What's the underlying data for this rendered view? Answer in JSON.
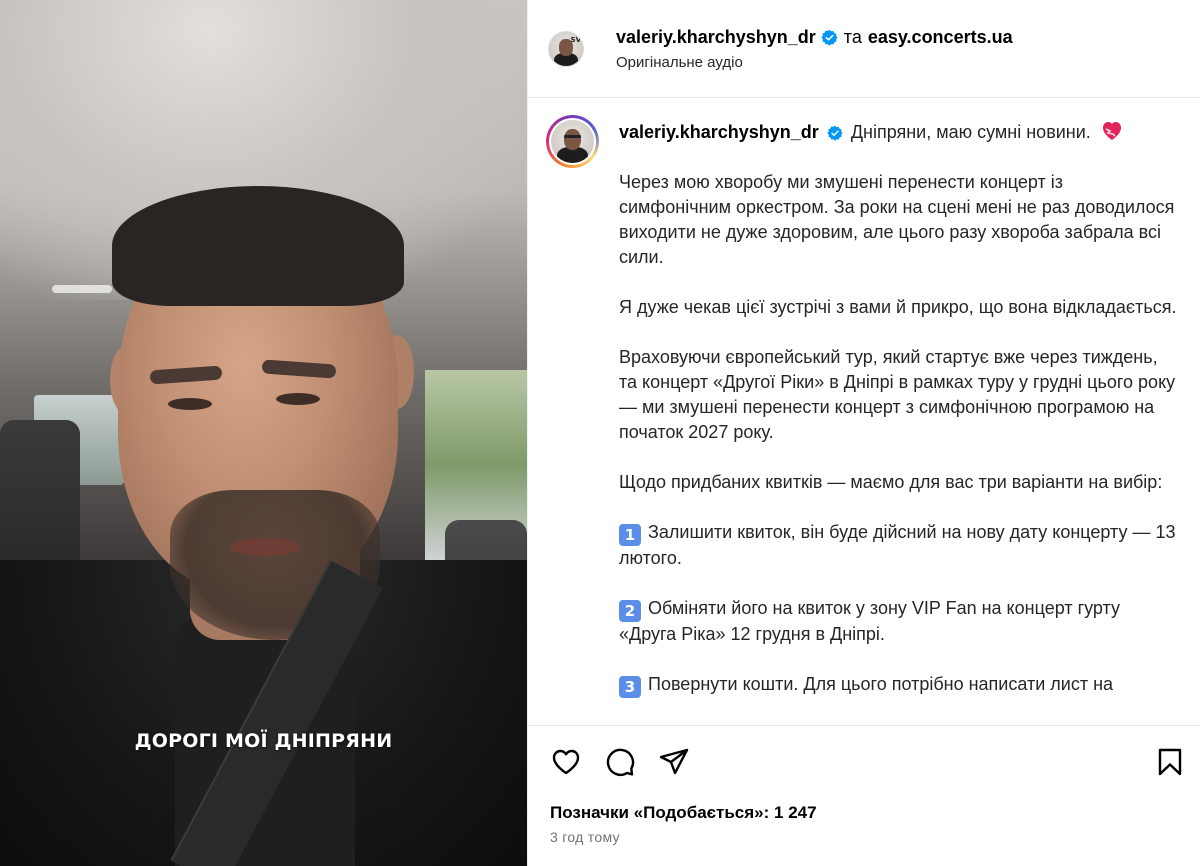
{
  "video": {
    "caption": "ДОРОГІ МОЇ ДНІПРЯНИ"
  },
  "header": {
    "username": "valeriy.kharchyshyn_dr",
    "conjunction": "та",
    "collaborator": "easy.concerts.ua",
    "audio_label": "Оригінальне аудіо",
    "avatar_tag": "SV",
    "verified_icon": "verified-badge-icon"
  },
  "post": {
    "username": "valeriy.kharchyshyn_dr",
    "first_line": "Дніпряни, маю сумні новини.",
    "heart_icon": "mending-heart-emoji",
    "paragraphs": [
      "Через мою хворобу ми змушені перенести концерт із симфонічним оркестром. За роки на сцені мені не раз доводилося виходити не дуже здоровим, але цього разу хвороба забрала всі сили.",
      "Я дуже чекав цієї зустрічі з вами й прикро, що вона відкладається.",
      "Враховуючи європейський тур, який стартує вже через тиждень, та концерт «Другої Ріки» в Дніпрі в рамках туру у грудні цього року — ми змушені перенести концерт з симфонічною програмою на початок 2027 року.",
      "Щодо придбаних квитків — маємо для вас три варіанти на вибір:"
    ],
    "options": [
      {
        "key": "1",
        "text": "Залишити квиток, він буде дійсний на нову дату концерту — 13 лютого."
      },
      {
        "key": "2",
        "text": "Обміняти його на квиток у зону VIP Fan на концерт гурту «Друга Ріка» 12 грудня в Дніпрі."
      },
      {
        "key": "3",
        "text": "Повернути кошти. Для цього потрібно написати лист на"
      }
    ]
  },
  "actions": {
    "like_icon": "heart-icon",
    "comment_icon": "comment-icon",
    "share_icon": "share-icon",
    "save_icon": "bookmark-icon",
    "likes_label": "Позначки «Подобається»:",
    "likes_count": "1 247",
    "timestamp": "3 год тому"
  },
  "colors": {
    "verified": "#0095f6",
    "keycap": "#5b8ee8",
    "muted_text": "#737373"
  }
}
